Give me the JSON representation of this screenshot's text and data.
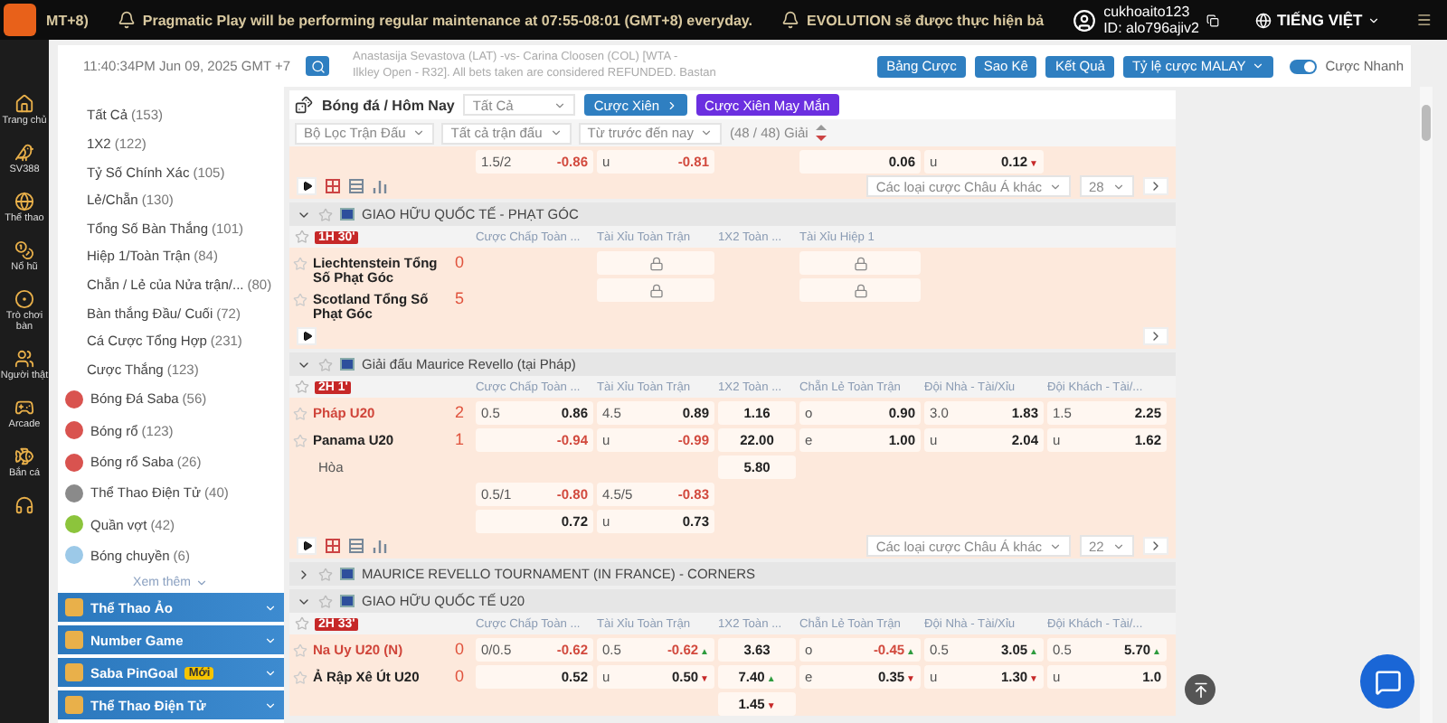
{
  "top_bar": {
    "ticker": [
      {
        "text": "MT+8)",
        "bell": false
      },
      {
        "text": "Pragmatic Play will be performing regular maintenance at 07:55-08:01 (GMT+8) everyday.",
        "bell": true
      },
      {
        "text": "EVOLUTION sẽ được thực hiện bả",
        "bell": true
      }
    ],
    "user": {
      "name": "cukhoaito123",
      "id": "ID: alo796ajiv2"
    },
    "language": "TIẾNG VIỆT"
  },
  "rail": [
    {
      "label": "Trang chủ"
    },
    {
      "label": "SV388"
    },
    {
      "label": "Thể thao"
    },
    {
      "label": "Nổ hũ"
    },
    {
      "label": "Trò chơi bàn"
    },
    {
      "label": "Người thật"
    },
    {
      "label": "Arcade"
    },
    {
      "label": "Bắn cá"
    }
  ],
  "info_bar": {
    "clock": "11:40:34PM Jun 09, 2025 GMT +7",
    "news": [
      "Anastasija Sevastova (LAT) -vs- Carina Cloosen (COL) [WTA -",
      "Ilkley Open - R32]. All bets taken are considered REFUNDED. Bastan"
    ],
    "buttons": [
      "Bảng Cược",
      "Sao Kê",
      "Kết Quả"
    ],
    "odds_type": "Tỷ lệ cược MALAY",
    "quick_bet": {
      "label": "Cược Nhanh",
      "on": true
    }
  },
  "sidebar": {
    "bet_types": [
      {
        "label": "Tất Cả",
        "count": "(153)"
      },
      {
        "label": "1X2",
        "count": "(122)"
      },
      {
        "label": "Tỷ Số Chính Xác",
        "count": "(105)"
      },
      {
        "label": "Lẻ/Chẵn",
        "count": "(130)"
      },
      {
        "label": "Tổng Số Bàn Thắng",
        "count": "(101)"
      },
      {
        "label": "Hiệp 1/Toàn Trận",
        "count": "(84)"
      },
      {
        "label": "Chẵn / Lẻ của Nửa trận/...",
        "count": "(80)"
      },
      {
        "label": "Bàn thắng Đầu/ Cuối",
        "count": "(72)"
      },
      {
        "label": "Cá Cược Tổng Hợp",
        "count": "(231)"
      },
      {
        "label": "Cược Thắng",
        "count": "(123)"
      }
    ],
    "sports": [
      {
        "label": "Bóng Đá Saba",
        "count": "(56)",
        "color": "#d9534f"
      },
      {
        "label": "Bóng rổ",
        "count": "(123)",
        "color": "#d9534f"
      },
      {
        "label": "Bóng rổ Saba",
        "count": "(26)",
        "color": "#d9534f"
      },
      {
        "label": "Thể Thao Điện Tử",
        "count": "(40)",
        "color": "#8a8a8a"
      },
      {
        "label": "Quần vợt",
        "count": "(42)",
        "color": "#8cc43c"
      },
      {
        "label": "Bóng chuyền",
        "count": "(6)",
        "color": "#9cc9e8"
      }
    ],
    "more": "Xem thêm",
    "sections": [
      {
        "label": "Thể Thao Ảo"
      },
      {
        "label": "Number Game"
      },
      {
        "label": "Saba PinGoal",
        "badge": "Mới"
      },
      {
        "label": "Thể Thao Điện Tử"
      }
    ]
  },
  "main": {
    "breadcrumb": "Bóng đá / Hôm Nay",
    "market_select": "Tất Cả",
    "parlay": "Cược Xiên",
    "lucky_parlay": "Cược Xiên May Mắn",
    "filters": [
      "Bộ Lọc Trận Đấu",
      "Tất cả trận đấu",
      "Từ trước đến nay"
    ],
    "league_count": "(48 / 48) Giải",
    "blocks": [
      {
        "kind": "tail",
        "lines": [
          [
            {
              "kind": "pair",
              "line": "1.5/2",
              "value": "-0.86",
              "negative": true
            },
            {
              "kind": "pair",
              "line": "u",
              "value": "-0.81",
              "negative": true
            },
            {
              "kind": "empty"
            },
            {
              "kind": "pair",
              "value": "0.06"
            },
            {
              "kind": "pair",
              "line": "u",
              "value": "0.12",
              "trend": {
                "mark": "▼",
                "up": false
              }
            }
          ]
        ],
        "toolbar": {
          "tools": true,
          "select": "Các loại cược Châu Á khác",
          "page": "28"
        }
      },
      {
        "kind": "league",
        "name": "GIAO HỮU QUỐC TẾ - PHẠT GÓC",
        "expanded": true,
        "time": "1H 30'",
        "columns": [
          "Cược Chấp Toàn ...",
          "Tài Xỉu Toàn Trận",
          "1X2 Toàn ...",
          "Tài Xỉu Hiệp 1"
        ],
        "teams": [
          {
            "name": "Liechtenstein Tổng Số Phạt Góc",
            "score": "0",
            "favorite": false
          },
          {
            "name": "Scotland Tổng Số Phạt Góc",
            "score": "5",
            "favorite": false
          }
        ],
        "lines": [
          [
            {
              "kind": "empty"
            },
            {
              "kind": "lock"
            },
            {
              "kind": "empty"
            },
            {
              "kind": "lock"
            }
          ],
          [
            {
              "kind": "empty"
            },
            {
              "kind": "lock"
            },
            {
              "kind": "empty"
            },
            {
              "kind": "lock"
            }
          ]
        ],
        "toolbar": {
          "tools": false
        }
      },
      {
        "kind": "league",
        "name": "Giải đấu Maurice Revello (tại Pháp)",
        "expanded": true,
        "time": "2H 1'",
        "columns": [
          "Cược Chấp Toàn ...",
          "Tài Xỉu Toàn Trận",
          "1X2 Toàn ...",
          "Chẵn Lẻ Toàn Trận",
          "Đội Nhà - Tài/Xỉu",
          "Đội Khách - Tài/..."
        ],
        "teams": [
          {
            "name": "Pháp U20",
            "score": "2",
            "favorite": true
          },
          {
            "name": "Panama U20",
            "score": "1",
            "favorite": false
          }
        ],
        "draw": "Hòa",
        "lines": [
          [
            {
              "kind": "pair",
              "line": "0.5",
              "value": "0.86"
            },
            {
              "kind": "pair",
              "line": "4.5",
              "value": "0.89"
            },
            {
              "kind": "single",
              "value": "1.16"
            },
            {
              "kind": "pair",
              "line": "o",
              "value": "0.90"
            },
            {
              "kind": "pair",
              "line": "3.0",
              "value": "1.83"
            },
            {
              "kind": "pair",
              "line": "1.5",
              "value": "2.25"
            }
          ],
          [
            {
              "kind": "pair",
              "value": "-0.94",
              "negative": true
            },
            {
              "kind": "pair",
              "line": "u",
              "value": "-0.99",
              "negative": true
            },
            {
              "kind": "single",
              "value": "22.00"
            },
            {
              "kind": "pair",
              "line": "e",
              "value": "1.00"
            },
            {
              "kind": "pair",
              "line": "u",
              "value": "2.04"
            },
            {
              "kind": "pair",
              "line": "u",
              "value": "1.62"
            }
          ],
          [
            {
              "kind": "empty"
            },
            {
              "kind": "empty"
            },
            {
              "kind": "single",
              "value": "5.80"
            }
          ],
          [
            {
              "kind": "pair",
              "line": "0.5/1",
              "value": "-0.80",
              "negative": true
            },
            {
              "kind": "pair",
              "line": "4.5/5",
              "value": "-0.83",
              "negative": true
            }
          ],
          [
            {
              "kind": "pair",
              "value": "0.72"
            },
            {
              "kind": "pair",
              "line": "u",
              "value": "0.73"
            }
          ]
        ],
        "toolbar": {
          "tools": true,
          "select": "Các loại cược Châu Á khác",
          "page": "22"
        }
      },
      {
        "kind": "league",
        "name": "MAURICE REVELLO TOURNAMENT (IN FRANCE) - CORNERS",
        "expanded": false
      },
      {
        "kind": "league",
        "name": "GIAO HỮU QUỐC TẾ U20",
        "expanded": true,
        "time": "2H 33'",
        "columns": [
          "Cược Chấp Toàn ...",
          "Tài Xỉu Toàn Trận",
          "1X2 Toàn ...",
          "Chẵn Lẻ Toàn Trận",
          "Đội Nhà - Tài/Xỉu",
          "Đội Khách - Tài/..."
        ],
        "teams": [
          {
            "name": "Na Uy U20 (N)",
            "score": "0",
            "favorite": true
          },
          {
            "name": "Ả Rập Xê Út U20",
            "score": "0",
            "favorite": false
          }
        ],
        "lines": [
          [
            {
              "kind": "pair",
              "line": "0/0.5",
              "value": "-0.62",
              "negative": true
            },
            {
              "kind": "pair",
              "line": "0.5",
              "value": "-0.62",
              "negative": true,
              "trend": {
                "mark": "▲",
                "up": true
              }
            },
            {
              "kind": "single",
              "value": "3.63"
            },
            {
              "kind": "pair",
              "line": "o",
              "value": "-0.45",
              "negative": true,
              "trend": {
                "mark": "▲",
                "up": true
              }
            },
            {
              "kind": "pair",
              "line": "0.5",
              "value": "3.05",
              "trend": {
                "mark": "▲",
                "up": true
              }
            },
            {
              "kind": "pair",
              "line": "0.5",
              "value": "5.70",
              "trend": {
                "mark": "▲",
                "up": true
              }
            }
          ],
          [
            {
              "kind": "pair",
              "value": "0.52"
            },
            {
              "kind": "pair",
              "line": "u",
              "value": "0.50",
              "trend": {
                "mark": "▼",
                "up": false
              }
            },
            {
              "kind": "single",
              "value": "7.40",
              "trend": {
                "mark": "▲",
                "up": true
              }
            },
            {
              "kind": "pair",
              "line": "e",
              "value": "0.35",
              "trend": {
                "mark": "▼",
                "up": false
              }
            },
            {
              "kind": "pair",
              "line": "u",
              "value": "1.30",
              "trend": {
                "mark": "▼",
                "up": false
              }
            },
            {
              "kind": "pair",
              "line": "u",
              "value": "1.0"
            }
          ],
          [
            {
              "kind": "empty"
            },
            {
              "kind": "empty"
            },
            {
              "kind": "single",
              "value": "1.45",
              "trend": {
                "mark": "▼",
                "up": false
              }
            }
          ]
        ]
      }
    ]
  }
}
